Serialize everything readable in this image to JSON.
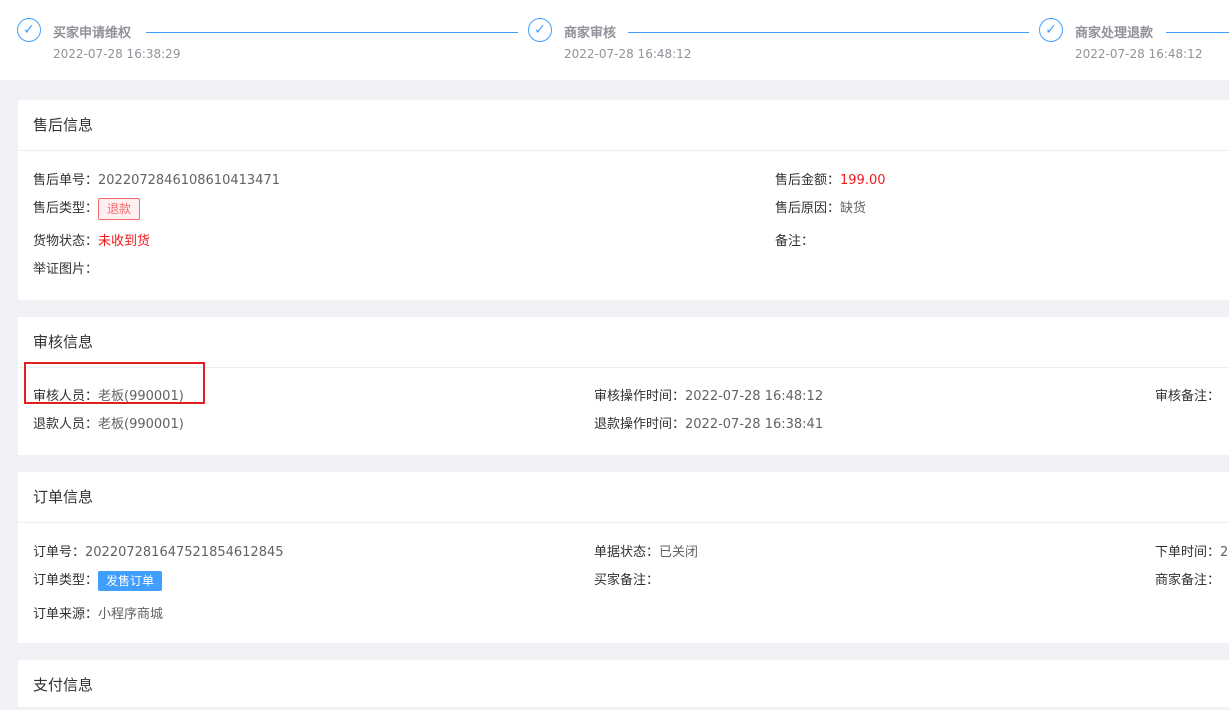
{
  "steps": [
    {
      "title": "买家申请维权",
      "time": "2022-07-28 16:38:29"
    },
    {
      "title": "商家审核",
      "time": "2022-07-28 16:48:12"
    },
    {
      "title": "商家处理退款",
      "time": "2022-07-28 16:48:12"
    }
  ],
  "after_sale": {
    "header": "售后信息",
    "no_label": "售后单号：",
    "no_value": "2022072846108610413471",
    "amount_label": "售后金额：",
    "amount_value": "199.00",
    "type_label": "售后类型：",
    "type_value": "退款",
    "reason_label": "售后原因：",
    "reason_value": "缺货",
    "goods_label": "货物状态：",
    "goods_value": "未收到货",
    "remark_label": "备注：",
    "proof_label": "举证图片："
  },
  "audit": {
    "header": "审核信息",
    "auditor_label": "审核人员：",
    "auditor_value": "老板(990001)",
    "audit_time_label": "审核操作时间：",
    "audit_time_value": "2022-07-28 16:48:12",
    "audit_remark_label": "审核备注：",
    "refunder_label": "退款人员：",
    "refunder_value": "老板(990001)",
    "refund_time_label": "退款操作时间：",
    "refund_time_value": "2022-07-28 16:38:41"
  },
  "order": {
    "header": "订单信息",
    "no_label": "订单号：",
    "no_value": "2022072816475218546128​45",
    "status_label": "单据状态：",
    "status_value": "已关闭",
    "order_time_label": "下单时间：",
    "order_time_value": "2",
    "type_label": "订单类型：",
    "type_value": "发售订单",
    "buyer_remark_label": "买家备注：",
    "merchant_remark_label": "商家备注：",
    "source_label": "订单来源：",
    "source_value": "小程序商城"
  },
  "payment": {
    "header": "支付信息"
  },
  "colors": {
    "accent": "#409eff",
    "danger": "#f01a1a",
    "highlight": "#e02020"
  }
}
